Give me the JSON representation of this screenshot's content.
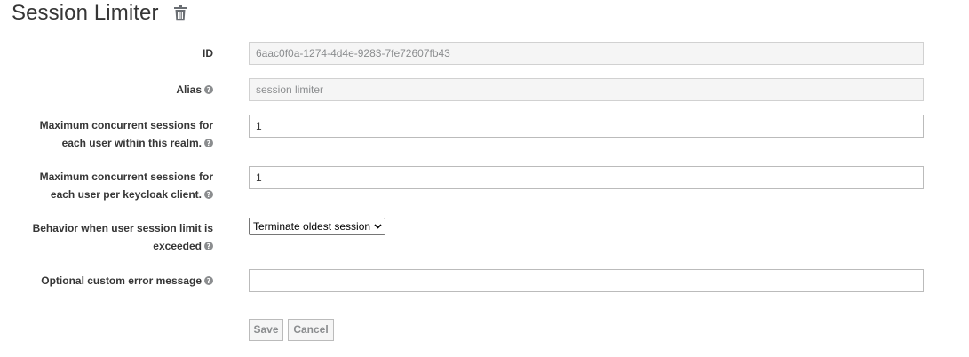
{
  "header": {
    "title": "Session Limiter",
    "delete_icon": "trash-icon"
  },
  "form": {
    "id": {
      "label": "ID",
      "value": "6aac0f0a-1274-4d4e-9283-7fe72607fb43"
    },
    "alias": {
      "label": "Alias",
      "value": "session limiter",
      "help_icon": "question-circle-icon"
    },
    "max_realm": {
      "label_line1": "Maximum concurrent sessions for",
      "label_line2": "each user within this realm.",
      "value": "1",
      "help_icon": "question-circle-icon"
    },
    "max_client": {
      "label_line1": "Maximum concurrent sessions for",
      "label_line2": "each user per keycloak client.",
      "value": "1",
      "help_icon": "question-circle-icon"
    },
    "behavior": {
      "label_line1": "Behavior when user session limit is",
      "label_line2": "exceeded",
      "selected": "Terminate oldest session",
      "help_icon": "question-circle-icon"
    },
    "error_message": {
      "label": "Optional custom error message",
      "value": "",
      "help_icon": "question-circle-icon"
    }
  },
  "actions": {
    "save_label": "Save",
    "cancel_label": "Cancel"
  }
}
